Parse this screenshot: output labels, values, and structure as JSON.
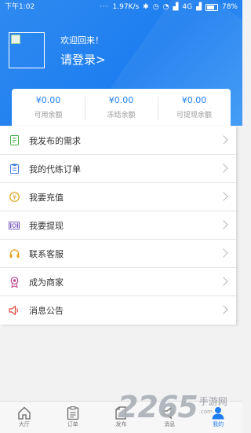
{
  "statusbar": {
    "time": "下午1:02",
    "dots": "···",
    "speed": "1.97K/s",
    "network": "4G",
    "battery": "78%"
  },
  "header": {
    "welcome": "欢迎回来！",
    "login": "请登录>"
  },
  "balances": [
    {
      "amount": "¥0.00",
      "label": "可用余额"
    },
    {
      "amount": "¥0.00",
      "label": "冻结余额"
    },
    {
      "amount": "¥0.00",
      "label": "可提现余额"
    }
  ],
  "menu": [
    {
      "label": "我发布的需求",
      "icon": "document-icon",
      "color": "#4caf50"
    },
    {
      "label": "我的代练订单",
      "icon": "clipboard-icon",
      "color": "#3f7fd8"
    },
    {
      "label": "我要充值",
      "icon": "coin-icon",
      "color": "#e0a21a"
    },
    {
      "label": "我要提现",
      "icon": "cash-icon",
      "color": "#7a5cc0"
    },
    {
      "label": "联系客服",
      "icon": "headset-icon",
      "color": "#e6a020"
    },
    {
      "label": "成为商家",
      "icon": "medal-icon",
      "color": "#c0478f"
    },
    {
      "label": "消息公告",
      "icon": "speaker-icon",
      "color": "#e0453a"
    }
  ],
  "tabs": [
    {
      "label": "大厅",
      "icon": "home-icon"
    },
    {
      "label": "订单",
      "icon": "order-icon"
    },
    {
      "label": "发布",
      "icon": "publish-icon"
    },
    {
      "label": "消息",
      "icon": "message-icon"
    },
    {
      "label": "我的",
      "icon": "user-icon",
      "active": true
    }
  ],
  "watermark": {
    "number": "2265",
    "suffix": ".com",
    "text": "手游网"
  },
  "colors": {
    "brand": "#1e7ef0",
    "background": "#f2f2f2"
  }
}
